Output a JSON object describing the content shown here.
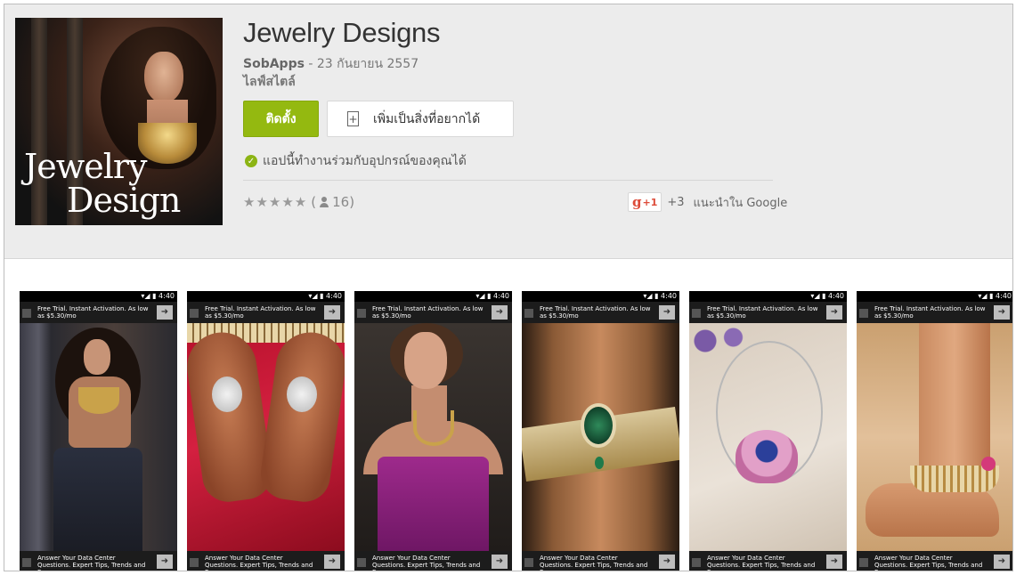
{
  "app": {
    "title": "Jewelry Designs",
    "developer": "SobApps",
    "date_separator": " - ",
    "date": "23 กันยายน 2557",
    "category": "ไลฟ์สไตล์",
    "cover_text_line1": "Jewelry",
    "cover_text_line2": "Design"
  },
  "actions": {
    "install_label": "ติดตั้ง",
    "wishlist_label": "เพิ่มเป็นสิ่งที่อยากได้",
    "wishlist_icon_glyph": "+"
  },
  "compatibility": {
    "icon_glyph": "✓",
    "text": "แอปนี้ทำงานร่วมกับอุปกรณ์ของคุณได้"
  },
  "rating": {
    "stars_text": "★★★★★",
    "paren_open": "(",
    "count": "16",
    "paren_close": ")"
  },
  "gplus": {
    "g_label": "g",
    "plus_label": "+1",
    "count": "+3",
    "recommend_text": "แนะนำใน Google"
  },
  "screenshots": [
    {
      "status_text": "▾◢ ▮ 4:40",
      "ad_top": "Free Trial. Instant Activation. As low as $5.30/mo",
      "ad_bottom": "Answer Your Data Center Questions. Expert Tips, Trends and Resources.",
      "arrow_glyph": "➜"
    },
    {
      "status_text": "▾◢ ▮ 4:40",
      "ad_top": "Free Trial. Instant Activation. As low as $5.30/mo",
      "ad_bottom": "Answer Your Data Center Questions. Expert Tips, Trends and Resources.",
      "arrow_glyph": "➜"
    },
    {
      "status_text": "▾◢ ▮ 4:40",
      "ad_top": "Free Trial. Instant Activation. As low as $5.30/mo",
      "ad_bottom": "Answer Your Data Center Questions. Expert Tips, Trends and Resources.",
      "arrow_glyph": "➜"
    },
    {
      "status_text": "▾◢ ▮ 4:40",
      "ad_top": "Free Trial. Instant Activation. As low as $5.30/mo",
      "ad_bottom": "Answer Your Data Center Questions. Expert Tips, Trends and Resources.",
      "arrow_glyph": "➜"
    },
    {
      "status_text": "▾◢ ▮ 4:40",
      "ad_top": "Free Trial. Instant Activation. As low as $5.30/mo",
      "ad_bottom": "Answer Your Data Center Questions. Expert Tips, Trends and Resources.",
      "arrow_glyph": "➜"
    },
    {
      "status_text": "▾◢ ▮ 4:40",
      "ad_top": "Free Trial. Instant Activation. As low as $5.30/mo",
      "ad_bottom": "Answer Your Data Center Questions. Expert Tips, Trends and Resources.",
      "arrow_glyph": "➜"
    }
  ],
  "colors": {
    "install_green": "#94b910",
    "header_bg": "#ececec",
    "gplus_red": "#dd4b39"
  },
  "icons": {
    "wishlist": "bookmark-plus-icon",
    "compatibility": "check-circle-icon",
    "rating_users": "person-icon",
    "gplus": "google-plus-icon",
    "ad_next": "arrow-right-icon"
  }
}
